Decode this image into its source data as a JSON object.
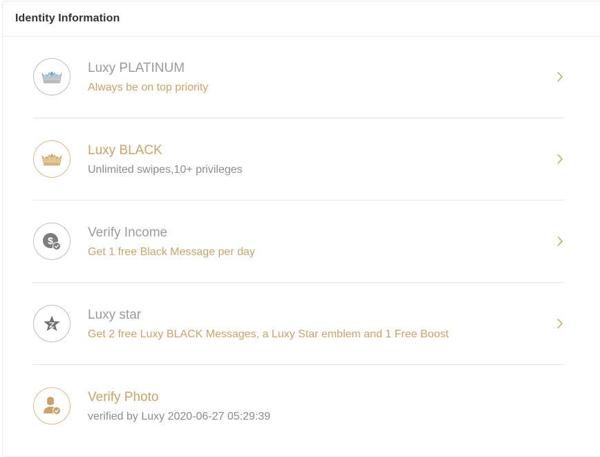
{
  "header": {
    "title": "Identity Information"
  },
  "colors": {
    "gold": "#c9a46a",
    "gray_text": "#9b9b9b",
    "subtitle_gray": "#8c8c8c",
    "title_dark": "#333333",
    "divider": "#e6e6e6"
  },
  "items": [
    {
      "title": "Luxy PLATINUM",
      "subtitle": "Always be on top priority",
      "icon": "platinum-crown-icon",
      "has_arrow": true
    },
    {
      "title": "Luxy BLACK",
      "subtitle": "Unlimited swipes,10+ privileges",
      "icon": "gold-crown-icon",
      "has_arrow": true
    },
    {
      "title": "Verify Income",
      "subtitle": "Get 1 free Black Message per day",
      "icon": "income-verify-icon",
      "has_arrow": true
    },
    {
      "title": "Luxy star",
      "subtitle": "Get 2 free Luxy BLACK Messages, a Luxy Star emblem and 1 Free Boost",
      "icon": "star-icon",
      "has_arrow": true
    },
    {
      "title": "Verify Photo",
      "subtitle": "verified by Luxy 2020-06-27 05:29:39",
      "icon": "photo-verify-icon",
      "has_arrow": false
    }
  ]
}
